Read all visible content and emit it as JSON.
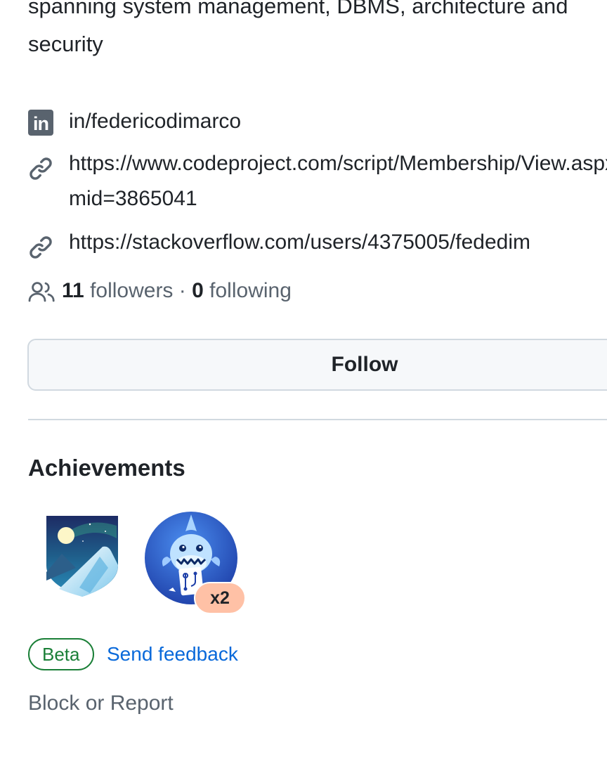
{
  "profile": {
    "bio_line1": "spanning system management, DBMS, architecture and",
    "bio_line2": "security"
  },
  "links": {
    "linkedin": {
      "icon": "linkedin-icon",
      "text": "in/federicodimarco"
    },
    "codeproject": {
      "icon": "link-icon",
      "line1": "https://www.codeproject.com/script/Membership/View.aspx?",
      "line2": "mid=3865041"
    },
    "stackoverflow": {
      "icon": "link-icon",
      "text": "https://stackoverflow.com/users/4375005/fededim"
    }
  },
  "social": {
    "icon": "people-icon",
    "followers_count": "11",
    "followers_label": "followers",
    "separator": "·",
    "following_count": "0",
    "following_label": "following"
  },
  "follow_button": {
    "label": "Follow"
  },
  "achievements": {
    "title": "Achievements",
    "badges": [
      {
        "icon": "arctic-code-vault-icon"
      },
      {
        "icon": "pull-shark-icon",
        "multiplier": "x2"
      }
    ]
  },
  "beta": {
    "badge": "Beta",
    "feedback_link": "Send feedback"
  },
  "block_report": "Block or Report",
  "colors": {
    "link": "#0969da",
    "beta_green": "#1a7f37",
    "muted": "#59636e",
    "multiplier_bg": "#ffc1a6"
  }
}
